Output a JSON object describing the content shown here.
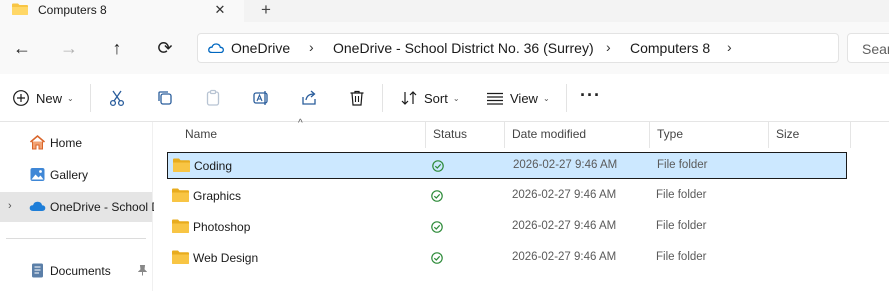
{
  "tab": {
    "title": "Computers 8",
    "close_glyph": "✕",
    "new_tab_glyph": "+"
  },
  "nav": {
    "back": "←",
    "forward": "→",
    "up": "↑",
    "refresh": "⟳"
  },
  "address": {
    "crumbs": [
      "OneDrive",
      "OneDrive - School District No. 36 (Surrey)",
      "Computers 8"
    ],
    "separator": "›"
  },
  "search": {
    "placeholder": "Sear"
  },
  "toolbar": {
    "new_label": "New",
    "sort_label": "Sort",
    "view_label": "View",
    "more_glyph": "···",
    "caret": "⌄"
  },
  "sidebar": {
    "items": [
      {
        "label": "Home",
        "icon": "home-icon"
      },
      {
        "label": "Gallery",
        "icon": "gallery-icon"
      },
      {
        "label": "OneDrive - School D",
        "icon": "onedrive-icon"
      },
      {
        "label": "Documents",
        "icon": "documents-icon"
      }
    ],
    "expand_glyph": "›",
    "pin_glyph": "📌"
  },
  "columns": {
    "name": "Name",
    "status": "Status",
    "date": "Date modified",
    "type": "Type",
    "size": "Size",
    "sort_glyph": "^"
  },
  "files": [
    {
      "name": "Coding",
      "status": "synced",
      "date": "2026-02-27 9:46 AM",
      "type": "File folder",
      "size": ""
    },
    {
      "name": "Graphics",
      "status": "synced",
      "date": "2026-02-27 9:46 AM",
      "type": "File folder",
      "size": ""
    },
    {
      "name": "Photoshop",
      "status": "synced",
      "date": "2026-02-27 9:46 AM",
      "type": "File folder",
      "size": ""
    },
    {
      "name": "Web Design",
      "status": "synced",
      "date": "2026-02-27 9:46 AM",
      "type": "File folder",
      "size": ""
    }
  ],
  "colors": {
    "accent": "#0067c0",
    "selection": "#cce8ff",
    "folder": "#f8c544",
    "synced": "#2e8b3a"
  }
}
